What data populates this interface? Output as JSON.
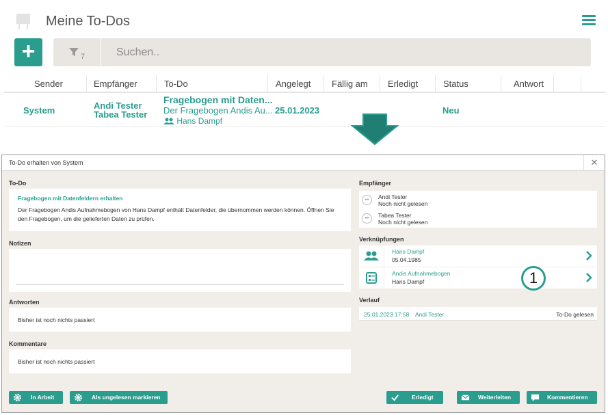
{
  "app": {
    "title": "Meine To-Dos",
    "accent_color": "#2a9d8f",
    "logo_icon": "easel-icon",
    "menu_icon": "hamburger-icon"
  },
  "toolbar": {
    "add_label": "+",
    "filter_count": "7",
    "search_placeholder": "Suchen.."
  },
  "table": {
    "columns": [
      "Sender",
      "Empfänger",
      "To-Do",
      "Angelegt",
      "Fällig am",
      "Erledigt",
      "Status",
      "Antwort"
    ],
    "rows": [
      {
        "sender": "System",
        "recipients": [
          "Andi Tester",
          "Tabea Tester"
        ],
        "todo_title": "Fragebogen mit Daten...",
        "todo_sub": "Der Fragebogen Andis Au...",
        "todo_person": "Hans Dampf",
        "created": "25.01.2023",
        "due": "",
        "done": "",
        "status": "Neu",
        "answer": ""
      }
    ]
  },
  "dialog": {
    "title": "To-Do erhalten von System",
    "close_label": "✕",
    "todo": {
      "label": "To-Do",
      "title": "Fragebogen mit Datenfeldern erhalten",
      "text": "Der Fragebogen Andis Aufnahmebogen von Hans Dampf enthält Datenfelder, die übernommen werden können. Öffnen Sie den Fragebogen, um die gelieferten Daten zu prüfen."
    },
    "notes": {
      "label": "Notizen"
    },
    "answers": {
      "label": "Antworten",
      "empty": "Bisher ist noch nichts passiert"
    },
    "comments": {
      "label": "Kommentare",
      "empty": "Bisher ist noch nichts passiert"
    },
    "recipients": {
      "label": "Empfänger",
      "items": [
        {
          "name": "Andi Tester",
          "status": "Noch nicht gelesen"
        },
        {
          "name": "Tabea Tester",
          "status": "Noch nicht gelesen"
        }
      ]
    },
    "links": {
      "label": "Verknüpfungen",
      "items": [
        {
          "main": "Hans Dampf",
          "sub": "05.04.1985",
          "icon": "people-icon"
        },
        {
          "main": "Andis Aufnahmebogen",
          "sub": "Hans Dampf",
          "icon": "form-icon"
        }
      ]
    },
    "history": {
      "label": "Verlauf",
      "items": [
        {
          "date": "25.01.2023 17:58",
          "user": "Andi Tester",
          "action": "To-Do gelesen"
        }
      ]
    },
    "buttons": {
      "in_progress": "In Arbeit",
      "mark_unread": "Als ungelesen markieren",
      "done": "Erledigt",
      "forward": "Weiterleiten",
      "comment": "Kommentieren"
    }
  },
  "annotation": {
    "marker": "1"
  }
}
